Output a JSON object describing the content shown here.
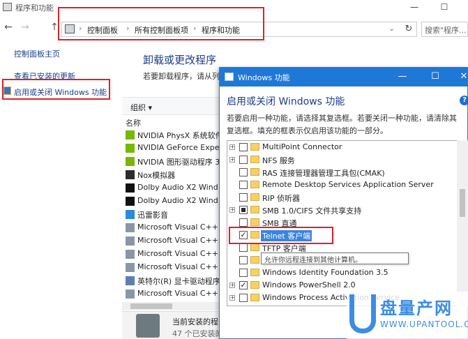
{
  "window": {
    "title": "程序和功能",
    "controls": [
      "—",
      "☐"
    ]
  },
  "nav": {
    "back": "←",
    "forward": "→",
    "up": "↑",
    "breadcrumbs": [
      "控制面板",
      "所有控制面板项",
      "程序和功能"
    ],
    "refresh": "↻",
    "search_placeholder": "搜索\"程序..."
  },
  "sidebar": {
    "items": [
      {
        "label": "控制面板主页"
      },
      {
        "label": "查看已安装的更新"
      },
      {
        "label": "启用或关闭 Windows 功能"
      }
    ]
  },
  "main": {
    "title": "卸载或更改程序",
    "description": "若要卸载程序，请从列",
    "organize": "组织 ▾",
    "column_name": "名称",
    "programs": [
      {
        "name": "NVIDIA PhysX 系统软件",
        "icon": "nvidia-icon"
      },
      {
        "name": "NVIDIA GeForce Expe",
        "icon": "nvidia-icon"
      },
      {
        "name": "NVIDIA 图形驱动程序 3",
        "icon": "nvidia-icon"
      },
      {
        "name": "Nox模拟器",
        "icon": "nox-icon"
      },
      {
        "name": "Dolby Audio X2 Wind",
        "icon": "dolby-icon"
      },
      {
        "name": "Dolby Audio X2 Wind",
        "icon": "dolby-icon"
      },
      {
        "name": "迅雷影音",
        "icon": "thunder-icon"
      },
      {
        "name": "Microsoft Visual C++",
        "icon": "installer-icon"
      },
      {
        "name": "Microsoft Visual C++",
        "icon": "installer-icon"
      },
      {
        "name": "Microsoft Visual C++",
        "icon": "installer-icon"
      },
      {
        "name": "Microsoft Visual C++",
        "icon": "installer-icon"
      },
      {
        "name": "英特尔(R) 显卡驱动程序",
        "icon": "intel-icon"
      },
      {
        "name": "Microsoft Visual C++",
        "icon": "installer-icon"
      }
    ],
    "status_title": "当前安装的程",
    "status_count": "47 个已安装的程"
  },
  "dialog": {
    "title": "Windows 功能",
    "controls": [
      "—",
      "☐",
      "✕"
    ],
    "heading": "启用或关闭 Windows 功能",
    "help": "?",
    "description": "若要启用一种功能，请选择其复选框。若要关闭一种功能，请清除其复选框。填充的框表示仅启用该功能的一部分。",
    "features": [
      {
        "label": "MultiPoint Connector",
        "expandable": true,
        "state": "off"
      },
      {
        "label": "NFS 服务",
        "expandable": true,
        "state": "off"
      },
      {
        "label": "RAS 连接管理器管理工具包(CMAK)",
        "expandable": false,
        "state": "off"
      },
      {
        "label": "Remote Desktop Services Application Server",
        "expandable": false,
        "state": "off"
      },
      {
        "label": "RIP 侦听器",
        "expandable": false,
        "state": "off"
      },
      {
        "label": "SMB 1.0/CIFS 文件共享支持",
        "expandable": true,
        "state": "partial"
      },
      {
        "label": "SMB 直通",
        "expandable": false,
        "state": "off"
      },
      {
        "label": "Telnet 客户端",
        "expandable": false,
        "state": "checked",
        "selected": true
      },
      {
        "label": "TFTP 客户端",
        "expandable": false,
        "state": "off"
      },
      {
        "label": "Windo",
        "expandable": false,
        "state": "off"
      },
      {
        "label": "Windows Identity Foundation 3.5",
        "expandable": false,
        "state": "off"
      },
      {
        "label": "Windows PowerShell 2.0",
        "expandable": true,
        "state": "checked"
      },
      {
        "label": "Windows Process Activation Service",
        "expandable": true,
        "state": "off"
      }
    ],
    "tooltip": "允许你远程连接到其他计算机。"
  },
  "watermark": {
    "brand_cn": "盘量产网",
    "brand_en": "WWW.UPANTOOL.COM"
  },
  "colors": {
    "accent": "#1e78d7",
    "highlight": "#e0202a",
    "link": "#1a3c8c",
    "title_blue": "#1e3d87"
  }
}
